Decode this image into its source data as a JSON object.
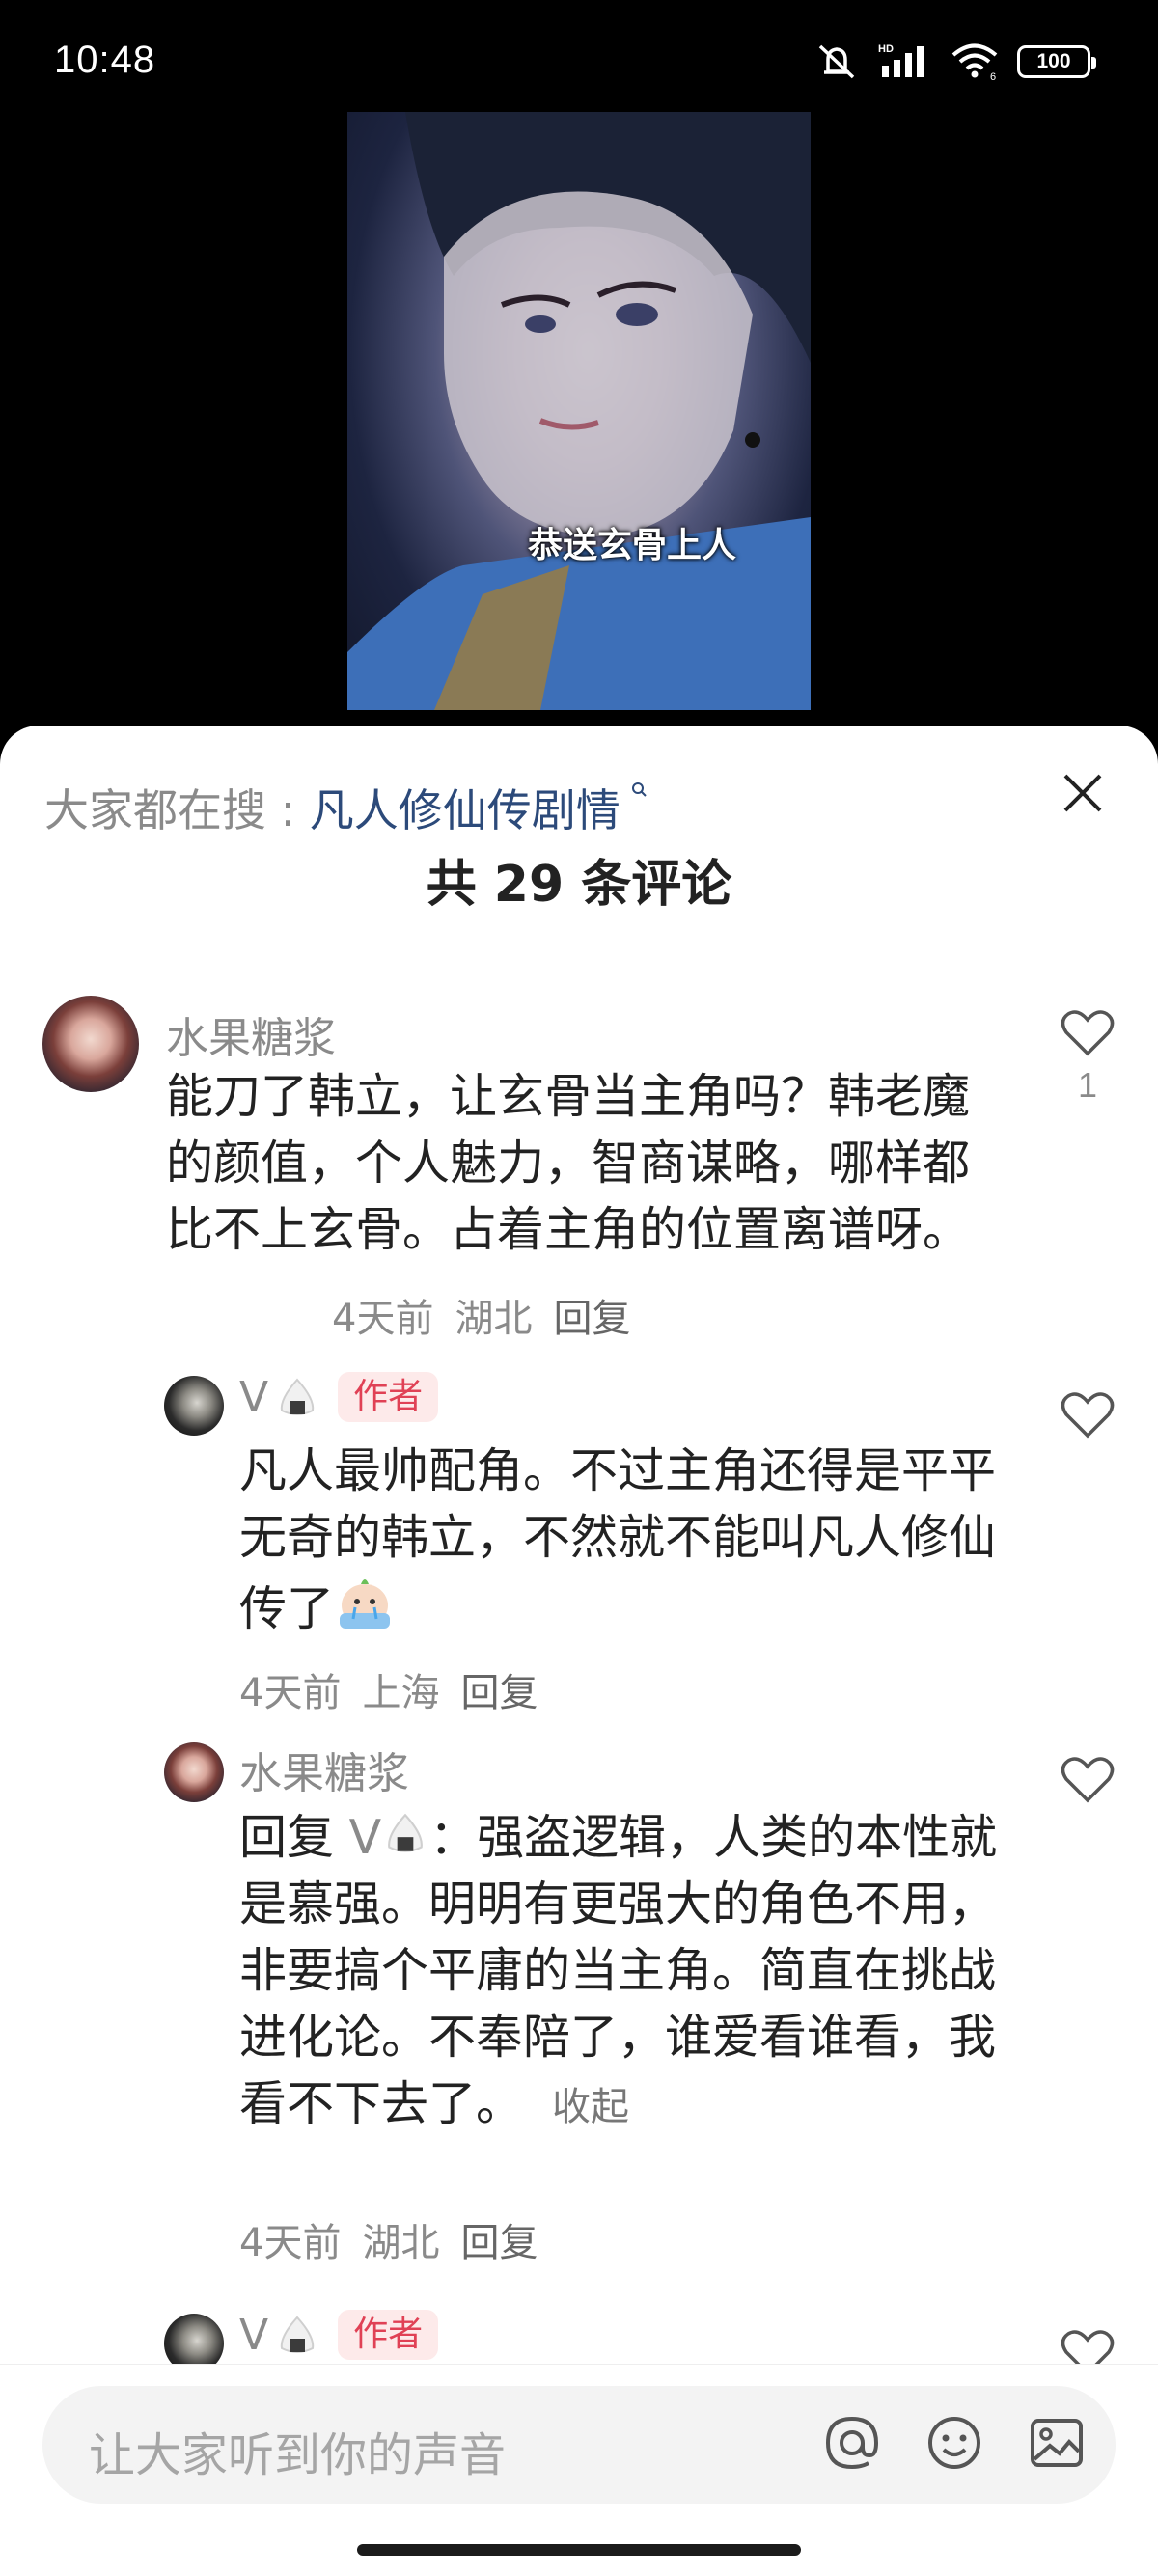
{
  "status_bar": {
    "time": "10:48",
    "battery": "100"
  },
  "video": {
    "subtitle": "恭送玄骨上人"
  },
  "sheet": {
    "search_prefix": "大家都在搜 : ",
    "search_term": "凡人修仙传剧情",
    "comment_count": "共 29 条评论"
  },
  "comments": [
    {
      "username": "水果糖浆",
      "text": "能刀了韩立，让玄骨当主角吗？韩老魔的颜值，个人魅力，智商谋略，哪样都比不上玄骨。占着主角的位置离谱呀。",
      "time": "4天前",
      "location": "湖北",
      "reply_label": "回复",
      "likes": "1"
    },
    {
      "username": "V",
      "tag": "作者",
      "text": "凡人最帅配角。不过主角还得是平平无奇的韩立，不然就不能叫凡人修仙传了",
      "time": "4天前",
      "location": "上海",
      "reply_label": "回复"
    },
    {
      "username": "水果糖浆",
      "reply_prefix": "回复",
      "reply_to": "V",
      "text": "：强盗逻辑，人类的本性就是慕强。明明有更强大的角色不用，非要搞个平庸的当主角。简直在挑战进化论。不奉陪了，谁爱看谁看，我看不下去了。",
      "collapse_label": "收起",
      "time": "4天前",
      "location": "湖北",
      "reply_label": "回复"
    },
    {
      "username": "V",
      "tag": "作者"
    }
  ],
  "input": {
    "placeholder": "让大家听到你的声音"
  },
  "icons": [
    "mute-icon",
    "signal-icon",
    "wifi-icon",
    "battery-icon",
    "search-icon",
    "close-icon",
    "heart-icon",
    "at-icon",
    "smiley-icon",
    "image-icon"
  ]
}
